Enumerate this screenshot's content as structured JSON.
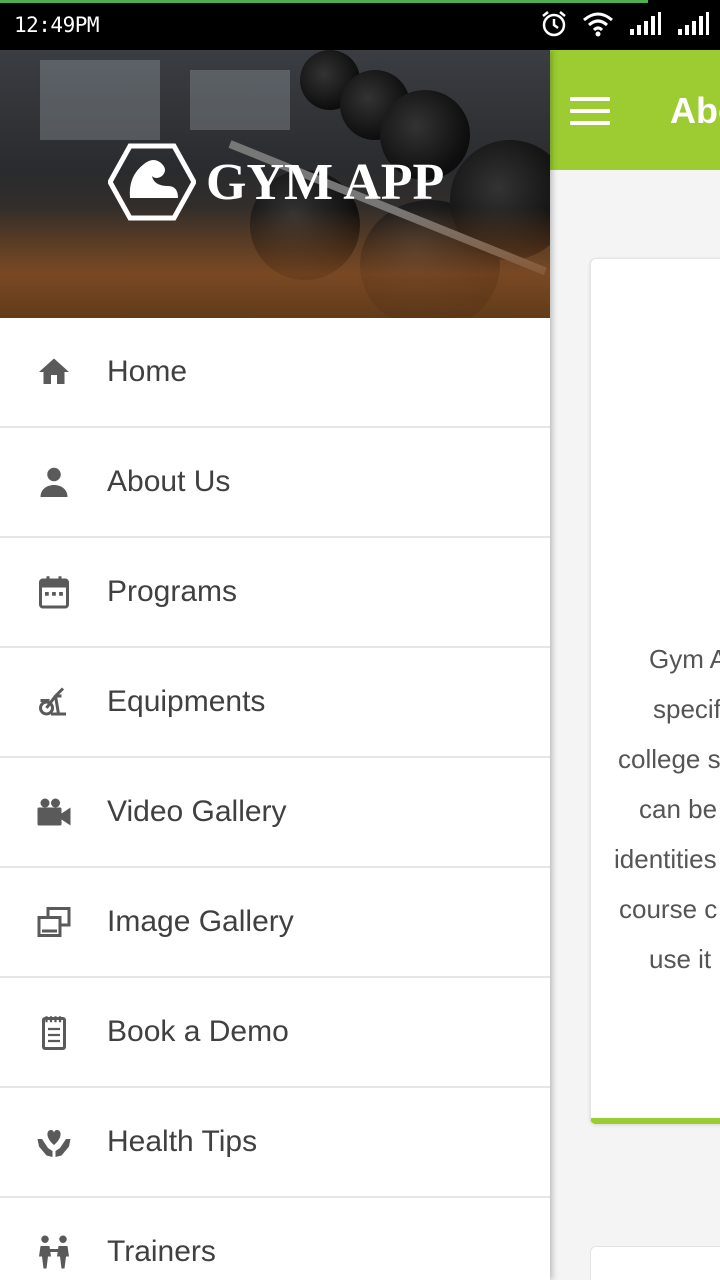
{
  "status_bar": {
    "time": "12:49PM",
    "icons": [
      "alarm-icon",
      "wifi-icon",
      "signal-icon",
      "signal-icon"
    ]
  },
  "toolbar": {
    "title": "Abo",
    "menu_icon": "hamburger-icon",
    "color": "#9ccc32"
  },
  "about_card": {
    "lines": [
      "Gym A",
      "specif",
      "college s",
      "can be",
      "identities",
      "course c",
      "use it"
    ]
  },
  "drawer": {
    "header": {
      "app_name": "GYM APP",
      "logo_icon": "flexed-arm-icon"
    },
    "items": [
      {
        "label": "Home",
        "icon": "home-icon"
      },
      {
        "label": "About Us",
        "icon": "person-icon"
      },
      {
        "label": "Programs",
        "icon": "calendar-icon"
      },
      {
        "label": "Equipments",
        "icon": "exercise-bike-icon"
      },
      {
        "label": "Video Gallery",
        "icon": "video-camera-icon"
      },
      {
        "label": "Image Gallery",
        "icon": "image-gallery-icon"
      },
      {
        "label": "Book a Demo",
        "icon": "notepad-icon"
      },
      {
        "label": "Health Tips",
        "icon": "heart-hands-icon"
      },
      {
        "label": "Trainers",
        "icon": "trainers-icon"
      }
    ]
  }
}
